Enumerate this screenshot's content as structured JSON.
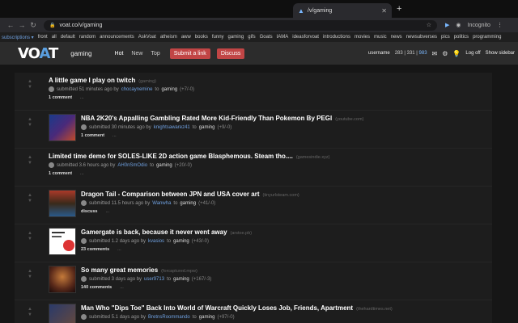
{
  "browser": {
    "tab_title": "/v/gaming",
    "url": "voat.co/v/gaming",
    "incognito_label": "Incognito"
  },
  "subscriptions": {
    "label": "subscriptions ▾",
    "items": [
      "front",
      "all",
      "default",
      "random",
      "announcements",
      "AskVoat",
      "atheism",
      "aww",
      "books",
      "funny",
      "gaming",
      "gifs",
      "Goats",
      "IAMA",
      "ideasforvoat",
      "introductions",
      "movies",
      "music",
      "news",
      "newsubverses",
      "pics",
      "politics",
      "programming"
    ]
  },
  "header": {
    "logo_main": "VO",
    "logo_accent": "A",
    "logo_end": "T",
    "subverse": "gaming",
    "tabs": [
      "Hot",
      "New",
      "Top"
    ],
    "submit_link": "Submit a link",
    "discuss": "Discuss",
    "username": "username",
    "points1": "283",
    "points2": "331",
    "points3": "983",
    "logoff": "Log off",
    "show_sidebar": "Show sidebar"
  },
  "posts": [
    {
      "title": "A little game I play on twitch",
      "domain": "(gaming)",
      "submitted": "submitted 51 minutes ago by",
      "user": "chocaynemine",
      "to": "to",
      "sub": "gaming",
      "score": "(+7/-0)",
      "comments": "1 comment",
      "more": "...",
      "thumb": ""
    },
    {
      "title": "NBA 2K20's Appalling Gambling Rated More Kid-Friendly Than Pokemon By PEGI",
      "domain": "(youtube.com)",
      "submitted": "submitted 30 minutes ago by",
      "user": "knightsawarez41",
      "to": "to",
      "sub": "gaming",
      "score": "(+9/-0)",
      "comments": "1 comment",
      "more": "...",
      "thumb": "t-nba"
    },
    {
      "title": "Limited time demo for SOLES-LIKE 2D action game Blasphemous. Steam tho....",
      "domain": "(gamesindie.xyz)",
      "submitted": "submitted 3.6 hours ago by",
      "user": "AH0nSmOdio",
      "to": "to",
      "sub": "gaming",
      "score": "(+20/-0)",
      "comments": "1 comment",
      "more": "...",
      "thumb": ""
    },
    {
      "title": "Dragon Tail - Comparison between JPN and USA cover art",
      "domain": "(tinyurlsteam.com)",
      "submitted": "submitted 11.5 hours ago by",
      "user": "Wanwha",
      "to": "to",
      "sub": "gaming",
      "score": "(+41/-0)",
      "comments": "discuss",
      "more": "...",
      "thumb": "t-drag"
    },
    {
      "title": "Gamergate is back, because it never went away",
      "domain": "(arstoe.pb)",
      "submitted": "submitted 1.2 days ago by",
      "user": "kvasios",
      "to": "to",
      "sub": "gaming",
      "score": "(+43/-0)",
      "comments": "23 comments",
      "more": "...",
      "thumb": "t-gg"
    },
    {
      "title": "So many great memories",
      "domain": "(forcaptured.mpw)",
      "submitted": "submitted 3 days ago by",
      "user": "user9713",
      "to": "to",
      "sub": "gaming",
      "score": "(+167/-3)",
      "comments": "140 comments",
      "more": "...",
      "thumb": "t-mem"
    },
    {
      "title": "Man Who \"Dips Toe\" Back Into World of Warcraft Quickly Loses Job, Friends, Apartment",
      "domain": "(thehardtimes.net)",
      "submitted": "submitted 5.1 days ago by",
      "user": "BretnsRoommando",
      "to": "to",
      "sub": "gaming",
      "score": "(+97/-0)",
      "comments": "",
      "more": "",
      "thumb": "t-wow"
    }
  ]
}
